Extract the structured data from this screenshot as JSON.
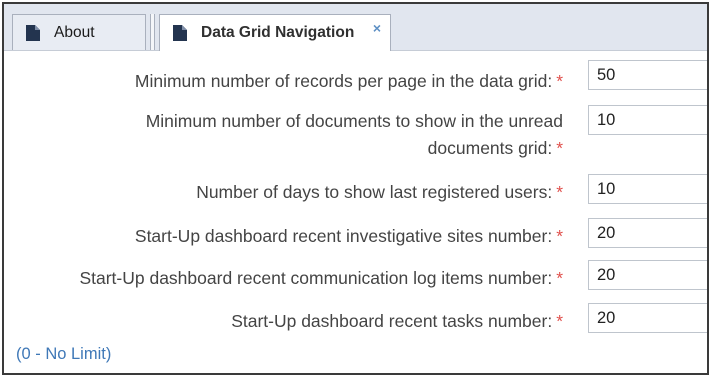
{
  "tabs": [
    {
      "label": "About",
      "icon": "document-icon"
    },
    {
      "label": "Data Grid Navigation",
      "icon": "document-icon",
      "close": "×"
    }
  ],
  "required_mark": "*",
  "fields": [
    {
      "label": "Minimum number of records per page in the data grid:",
      "value": "50"
    },
    {
      "label_line1": "Minimum number of documents to show in the unread",
      "label_line2": "documents grid:",
      "value": "10"
    },
    {
      "label": "Number of days to show last registered users:",
      "value": "10"
    },
    {
      "label": "Start-Up dashboard recent investigative sites number:",
      "value": "20"
    },
    {
      "label": "Start-Up dashboard recent communication log items number:",
      "value": "20"
    },
    {
      "label": "Start-Up dashboard recent tasks number:",
      "value": "20"
    }
  ],
  "note": "(0 - No Limit)",
  "colors": {
    "required": "#e0504c",
    "link": "#3f78b7",
    "tabbar": "#e1e6ef"
  }
}
